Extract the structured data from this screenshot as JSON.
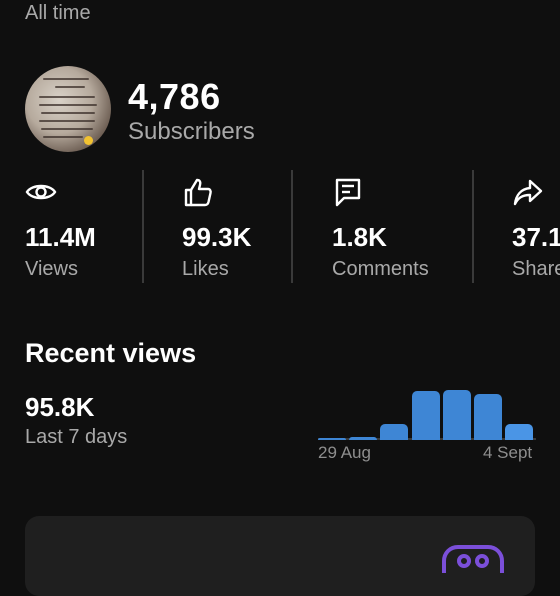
{
  "period": "All time",
  "subscribers": {
    "count": "4,786",
    "label": "Subscribers"
  },
  "stats": [
    {
      "icon": "eye-icon",
      "value": "11.4M",
      "label": "Views"
    },
    {
      "icon": "thumbs-up-icon",
      "value": "99.3K",
      "label": "Likes"
    },
    {
      "icon": "comment-icon",
      "value": "1.8K",
      "label": "Comments"
    },
    {
      "icon": "share-icon",
      "value": "37.1",
      "label": "Share"
    }
  ],
  "recent": {
    "title": "Recent views",
    "value": "95.8K",
    "range_label": "Last 7 days",
    "start_label": "29 Aug",
    "end_label": "4 Sept",
    "daily_fraction": [
      0.02,
      0.05,
      0.28,
      0.88,
      0.9,
      0.82,
      0.28
    ]
  },
  "colors": {
    "accent": "#3e86d5",
    "card_icon": "#7b4fd9"
  }
}
